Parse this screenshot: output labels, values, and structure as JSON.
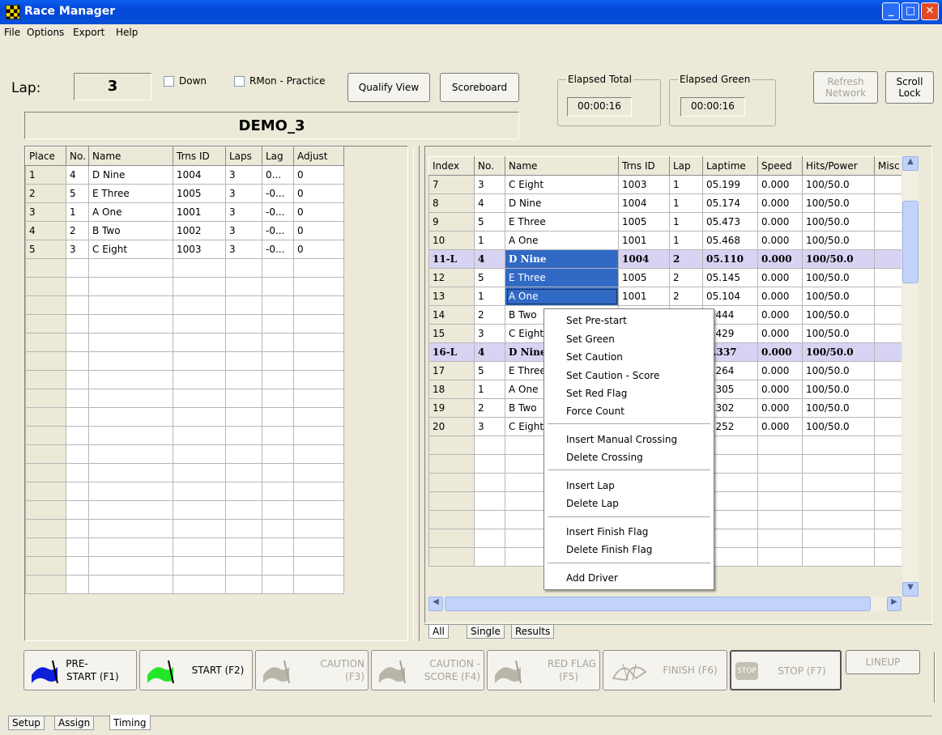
{
  "window": {
    "title": "Race Manager"
  },
  "menu": [
    "File",
    "Options",
    "Export",
    "Help"
  ],
  "toolbar": {
    "lap_label": "Lap:",
    "lap_value": "3",
    "down_label": "Down",
    "rmon_label": "RMon - Practice",
    "qualify_view": "Qualify View",
    "scoreboard": "Scoreboard",
    "elapsed_total_label": "Elapsed Total",
    "elapsed_total_value": "00:00:16",
    "elapsed_green_label": "Elapsed Green",
    "elapsed_green_value": "00:00:16",
    "refresh_line1": "Refresh",
    "refresh_line2": "Network",
    "scroll_line1": "Scroll",
    "scroll_line2": "Lock",
    "race_name": "DEMO_3"
  },
  "standings": {
    "columns": [
      "Place",
      "No.",
      "Name",
      "Trns ID",
      "Laps",
      "Lag",
      "Adjust"
    ],
    "rows": [
      [
        "1",
        "4",
        "D Nine",
        "1004",
        "3",
        "0...",
        "0"
      ],
      [
        "2",
        "5",
        "E Three",
        "1005",
        "3",
        "-0...",
        "0"
      ],
      [
        "3",
        "1",
        "A One",
        "1001",
        "3",
        "-0...",
        "0"
      ],
      [
        "4",
        "2",
        "B Two",
        "1002",
        "3",
        "-0...",
        "0"
      ],
      [
        "5",
        "3",
        "C Eight",
        "1003",
        "3",
        "-0...",
        "0"
      ]
    ]
  },
  "crossings": {
    "columns": [
      "Index",
      "No.",
      "Name",
      "Trns ID",
      "Lap",
      "Laptime",
      "Speed",
      "Hits/Power",
      "Misc"
    ],
    "rows": [
      [
        "7",
        "3",
        "C Eight",
        "1003",
        "1",
        "05.199",
        "0.000",
        "100/50.0",
        ""
      ],
      [
        "8",
        "4",
        "D Nine",
        "1004",
        "1",
        "05.174",
        "0.000",
        "100/50.0",
        ""
      ],
      [
        "9",
        "5",
        "E Three",
        "1005",
        "1",
        "05.473",
        "0.000",
        "100/50.0",
        ""
      ],
      [
        "10",
        "1",
        "A One",
        "1001",
        "1",
        "05.468",
        "0.000",
        "100/50.0",
        ""
      ],
      [
        "11-L",
        "4",
        "D Nine",
        "1004",
        "2",
        "05.110",
        "0.000",
        "100/50.0",
        ""
      ],
      [
        "12",
        "5",
        "E Three",
        "1005",
        "2",
        "05.145",
        "0.000",
        "100/50.0",
        ""
      ],
      [
        "13",
        "1",
        "A One",
        "1001",
        "2",
        "05.104",
        "0.000",
        "100/50.0",
        ""
      ],
      [
        "14",
        "2",
        "B Two",
        "",
        "",
        "5.444",
        "0.000",
        "100/50.0",
        ""
      ],
      [
        "15",
        "3",
        "C Eight",
        "",
        "",
        "5.429",
        "0.000",
        "100/50.0",
        ""
      ],
      [
        "16-L",
        "4",
        "D Nine",
        "",
        "",
        "5.337",
        "0.000",
        "100/50.0",
        ""
      ],
      [
        "17",
        "5",
        "E Three",
        "",
        "",
        "5.264",
        "0.000",
        "100/50.0",
        ""
      ],
      [
        "18",
        "1",
        "A One",
        "",
        "",
        "5.305",
        "0.000",
        "100/50.0",
        ""
      ],
      [
        "19",
        "2",
        "B Two",
        "",
        "",
        "5.302",
        "0.000",
        "100/50.0",
        ""
      ],
      [
        "20",
        "3",
        "C Eight",
        "",
        "",
        "5.252",
        "0.000",
        "100/50.0",
        ""
      ]
    ],
    "bold_rows": [
      4,
      9
    ]
  },
  "subtabs": [
    "All",
    "Single",
    "Results"
  ],
  "context_menu": [
    "Set Pre-start",
    "Set Green",
    "Set Caution",
    "Set Caution - Score",
    "Set Red Flag",
    "Force Count",
    "Insert Manual Crossing",
    "Delete Crossing",
    "Insert Lap",
    "Delete Lap",
    "Insert Finish Flag",
    "Delete Finish Flag",
    "Add Driver"
  ],
  "flags": {
    "prestart_1": "PRE-",
    "prestart_2": "START (F1)",
    "start": "START (F2)",
    "caution_1": "CAUTION",
    "caution_2": "(F3)",
    "cscore_1": "CAUTION -",
    "cscore_2": "SCORE (F4)",
    "red_1": "RED FLAG",
    "red_2": "(F5)",
    "finish": "FINISH (F6)",
    "stop_icon": "STOP",
    "stop": "STOP (F7)",
    "lineup": "LINEUP"
  },
  "bottom_tabs": [
    "Setup",
    "Assign",
    "Timing"
  ],
  "colors": {
    "title_blue": "#0348d8",
    "selection": "#316ac5",
    "lap_row": "#d7d4f3"
  }
}
